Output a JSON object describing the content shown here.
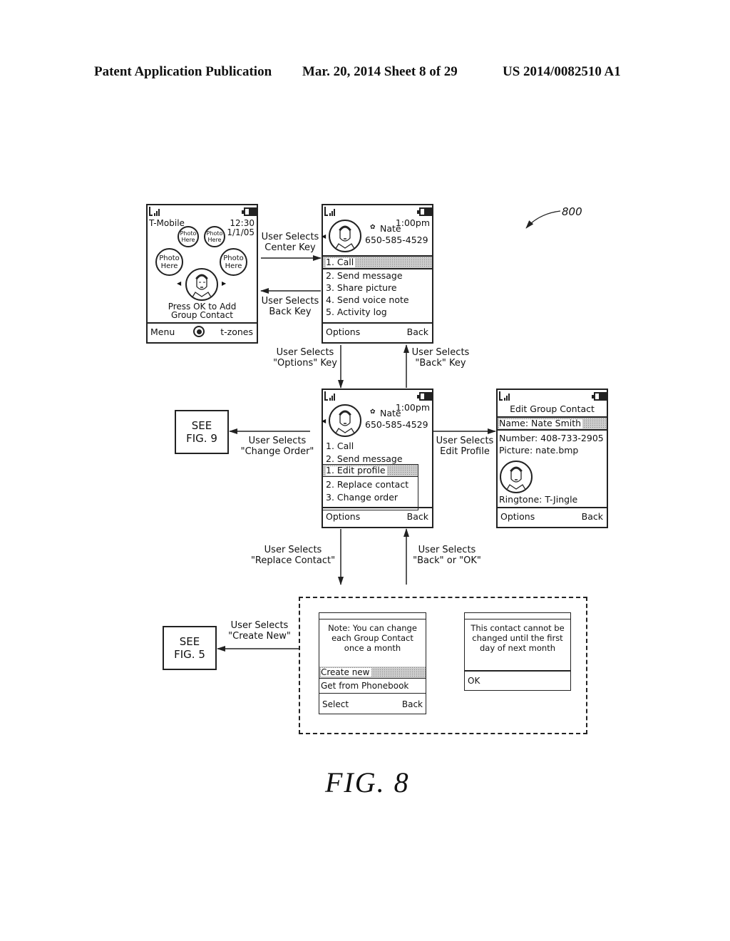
{
  "header": {
    "left": "Patent Application Publication",
    "center": "Mar. 20, 2014  Sheet 8 of 29",
    "right": "US 2014/0082510 A1"
  },
  "reference_numeral": "800",
  "figure_label": "FIG. 8",
  "screens": {
    "home": {
      "carrier": "T-Mobile",
      "time": "12:30",
      "date": "1/1/05",
      "photo_placeholder": [
        "Photo",
        "Here"
      ],
      "prompt": [
        "Press OK to Add",
        "Group Contact"
      ],
      "soft_left": "Menu",
      "soft_right": "t-zones",
      "icons": [
        "signal-icon",
        "battery-icon",
        "center-key-icon",
        "face-photo-icon"
      ]
    },
    "contact_menu": {
      "time": "1:00pm",
      "name": "Nate",
      "number": "650-585-4529",
      "items": [
        "1. Call",
        "2. Send  message",
        "3. Share  picture",
        "4. Send  voice  note",
        "5. Activity  log"
      ],
      "selected_index": 0,
      "soft_left": "Options",
      "soft_right": "Back"
    },
    "options_menu": {
      "time": "1:00pm",
      "name": "Nate",
      "number": "650-585-4529",
      "base_items": [
        "1. Call",
        "2. Send  message"
      ],
      "popup_items": [
        "1. Edit  profile",
        "2. Replace  contact",
        "3. Change  order"
      ],
      "selected_index": 0,
      "soft_left": "Options",
      "soft_right": "Back"
    },
    "edit_group_contact": {
      "title": "Edit  Group  Contact",
      "name_field": "Name:  Nate  Smith",
      "number_field": "Number:  408-733-2905",
      "picture_field": "Picture:  nate.bmp",
      "ringtone_field": "Ringtone:  T-Jingle",
      "soft_left": "Options",
      "soft_right": "Back"
    },
    "replace_note": {
      "message": [
        "Note: You can change",
        "each Group Contact",
        "once a month"
      ],
      "items": [
        "Create  new",
        "Get  from  Phonebook"
      ],
      "selected_index": 0,
      "soft_left": "Select",
      "soft_right": "Back"
    },
    "cannot_change": {
      "message": [
        "This contact cannot be",
        "changed until the first",
        "day of next month"
      ],
      "ok": "OK"
    }
  },
  "references": {
    "fig9": [
      "SEE",
      "FIG. 9"
    ],
    "fig5": [
      "SEE",
      "FIG. 5"
    ]
  },
  "transitions": {
    "center_key": [
      "User  Selects",
      "Center  Key"
    ],
    "back_key": [
      "User  Selects",
      "Back  Key"
    ],
    "options_key": [
      "User  Selects",
      "\"Options\"  Key"
    ],
    "back_key_quoted": [
      "User  Selects",
      "\"Back\"  Key"
    ],
    "change_order": [
      "User  Selects",
      "\"Change  Order\""
    ],
    "edit_profile": [
      "User  Selects",
      "Edit  Profile"
    ],
    "replace_contact": [
      "User  Selects",
      "\"Replace  Contact\""
    ],
    "back_or_ok": [
      "User  Selects",
      "\"Back\"  or  \"OK\""
    ],
    "create_new": [
      "User  Selects",
      "\"Create  New\""
    ]
  }
}
